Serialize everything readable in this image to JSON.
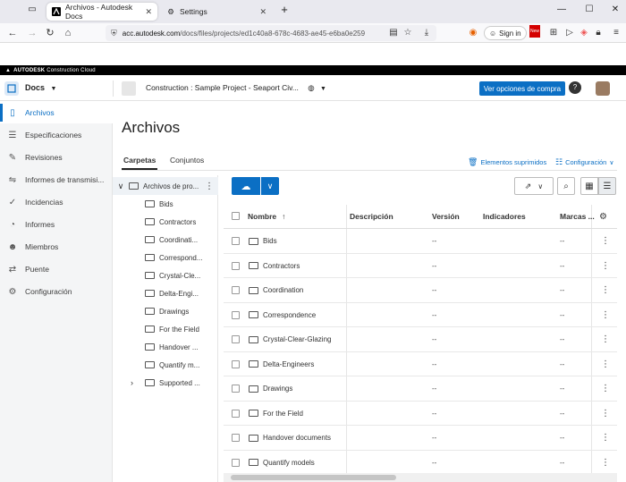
{
  "browser": {
    "tabs": [
      {
        "title": "Archivos - Autodesk Docs",
        "active": true
      },
      {
        "title": "Settings",
        "active": false
      }
    ],
    "url_host": "acc.autodesk.com",
    "url_path": "/docs/files/projects/ed1c40a8-678c-4683-ae45-e6ba0e259",
    "sign_in": "Sign in",
    "new_badge": "New"
  },
  "brand_bar": {
    "brand": "AUTODESK",
    "product": "Construction Cloud"
  },
  "header": {
    "module": "Docs",
    "project": "Construction : Sample Project - Seaport Civ...",
    "buy_label": "Ver opciones de compra",
    "help": "?"
  },
  "sidebar": {
    "items": [
      {
        "label": "Archivos",
        "icon": "file-icon",
        "active": true
      },
      {
        "label": "Especificaciones",
        "icon": "specs-icon",
        "active": false
      },
      {
        "label": "Revisiones",
        "icon": "review-icon",
        "active": false
      },
      {
        "label": "Informes de transmisi...",
        "icon": "transmittal-icon",
        "active": false
      },
      {
        "label": "Incidencias",
        "icon": "issue-icon",
        "active": false
      },
      {
        "label": "Informes",
        "icon": "report-icon",
        "active": false
      },
      {
        "label": "Miembros",
        "icon": "members-icon",
        "active": false
      },
      {
        "label": "Puente",
        "icon": "bridge-icon",
        "active": false
      },
      {
        "label": "Configuración",
        "icon": "gear-icon",
        "active": false
      }
    ]
  },
  "main": {
    "title": "Archivos",
    "tabs": [
      "Carpetas",
      "Conjuntos"
    ],
    "deleted_items": "Elementos suprimidos",
    "settings": "Configuración"
  },
  "tree": {
    "root": "Archivos de pro...",
    "folders": [
      "Bids",
      "Contractors",
      "Coordinati...",
      "Correspond...",
      "Crystal-Cle...",
      "Delta-Engi...",
      "Drawings",
      "For the Field",
      "Handover ...",
      "Quantify m...",
      "Supported ..."
    ]
  },
  "table": {
    "columns": {
      "name": "Nombre",
      "description": "Descripción",
      "version": "Versión",
      "indicators": "Indicadores",
      "marks": "Marcas ..."
    },
    "rows": [
      {
        "name": "Bids",
        "version": "--",
        "marks": "--"
      },
      {
        "name": "Contractors",
        "version": "--",
        "marks": "--"
      },
      {
        "name": "Coordination",
        "version": "--",
        "marks": "--"
      },
      {
        "name": "Correspondence",
        "version": "--",
        "marks": "--"
      },
      {
        "name": "Crystal-Clear-Glazing",
        "version": "--",
        "marks": "--"
      },
      {
        "name": "Delta-Engineers",
        "version": "--",
        "marks": "--"
      },
      {
        "name": "Drawings",
        "version": "--",
        "marks": "--"
      },
      {
        "name": "For the Field",
        "version": "--",
        "marks": "--"
      },
      {
        "name": "Handover documents",
        "version": "--",
        "marks": "--"
      },
      {
        "name": "Quantify models",
        "version": "--",
        "marks": "--"
      }
    ]
  },
  "colors": {
    "accent": "#0b6fc4",
    "brand_bar": "#000000"
  }
}
